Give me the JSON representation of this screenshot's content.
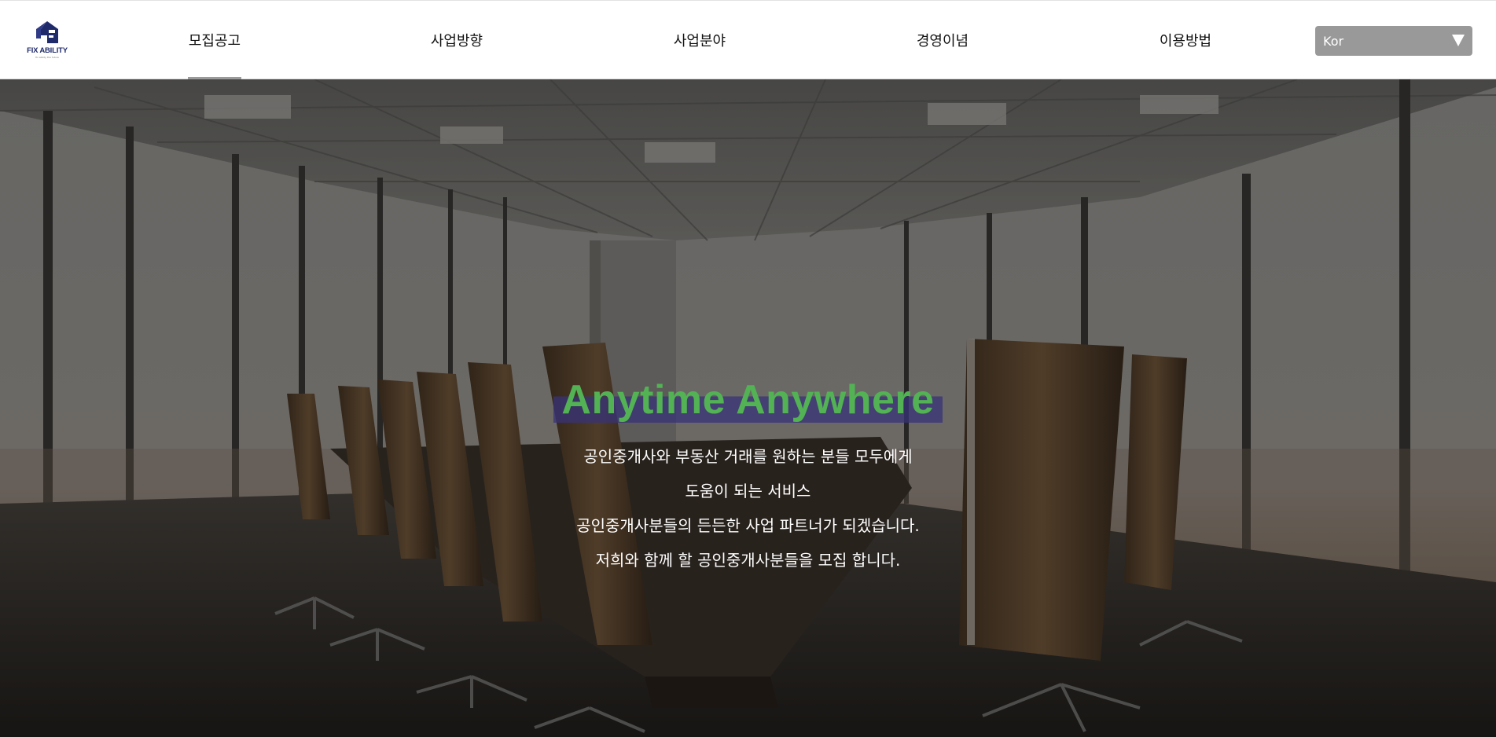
{
  "header": {
    "logo_text": "FIX ABILITY",
    "logo_sub": "fix ability the future",
    "nav": [
      {
        "label": "모집공고",
        "active": true
      },
      {
        "label": "사업방향",
        "active": false
      },
      {
        "label": "사업분야",
        "active": false
      },
      {
        "label": "경영이념",
        "active": false
      },
      {
        "label": "이용방법",
        "active": false
      }
    ],
    "language": {
      "selected": "Kor"
    }
  },
  "hero": {
    "title": "Anytime Anywhere",
    "lines": [
      "공인중개사와 부동산 거래를 원하는 분들 모두에게",
      "도움이 되는 서비스",
      "공인중개사분들의 든든한 사업 파트너가 되겠습니다.",
      "저희와 함께 할 공인중개사분들을 모집 합니다."
    ]
  },
  "colors": {
    "title_green": "#52b254",
    "logo_navy": "#1f2a6b",
    "select_gray": "#999999"
  }
}
